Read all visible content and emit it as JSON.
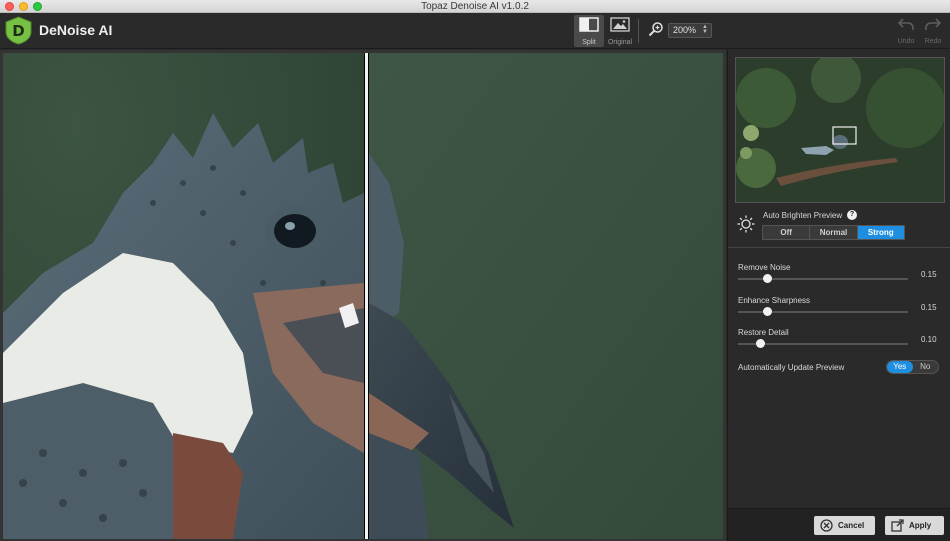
{
  "window": {
    "title": "Topaz Denoise AI v1.0.2"
  },
  "app": {
    "name": "DeNoise AI",
    "logo_letter": "D"
  },
  "toolbar": {
    "split_label": "Split",
    "original_label": "Original",
    "zoom_value": "200%",
    "undo_label": "Undo",
    "redo_label": "Redo"
  },
  "preview": {
    "auto_brighten_label": "Auto Brighten Preview",
    "help_glyph": "?",
    "modes": [
      "Off",
      "Normal",
      "Strong"
    ],
    "selected_mode": "Strong"
  },
  "sliders": [
    {
      "label": "Remove Noise",
      "value": "0.15",
      "fraction": 0.15
    },
    {
      "label": "Enhance Sharpness",
      "value": "0.15",
      "fraction": 0.15
    },
    {
      "label": "Restore Detail",
      "value": "0.10",
      "fraction": 0.1
    }
  ],
  "auto_update": {
    "label": "Automatically Update Preview",
    "yes": "Yes",
    "no": "No",
    "selected": "Yes"
  },
  "footer": {
    "cancel_label": "Cancel",
    "apply_label": "Apply"
  },
  "colors": {
    "accent": "#1e8fe0",
    "logo_green": "#76c043",
    "background": "#2a2a2a"
  }
}
